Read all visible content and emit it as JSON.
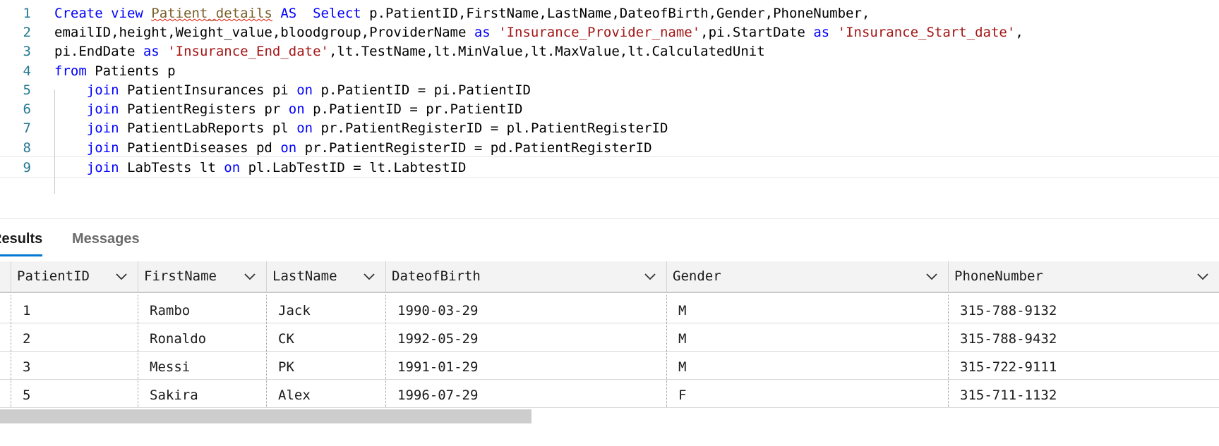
{
  "editor": {
    "line_numbers": [
      "1",
      "2",
      "3",
      "4",
      "5",
      "6",
      "7",
      "8",
      "9"
    ],
    "lines": [
      [
        {
          "t": "Create view ",
          "c": "kw"
        },
        {
          "t": "Patient_details",
          "c": "id-warn"
        },
        {
          "t": " AS  ",
          "c": "kw"
        },
        {
          "t": "Select",
          "c": "kw"
        },
        {
          "t": " p.PatientID,FirstName,LastName,DateofBirth,Gender,PhoneNumber,",
          "c": ""
        }
      ],
      [
        {
          "t": "emailID,height,Weight_value,bloodgroup,ProviderName ",
          "c": ""
        },
        {
          "t": "as",
          "c": "kw"
        },
        {
          "t": " ",
          "c": ""
        },
        {
          "t": "'Insurance_Provider_name'",
          "c": "str"
        },
        {
          "t": ",pi.StartDate ",
          "c": ""
        },
        {
          "t": "as",
          "c": "kw"
        },
        {
          "t": " ",
          "c": ""
        },
        {
          "t": "'Insurance_Start_date'",
          "c": "str"
        },
        {
          "t": ",",
          "c": ""
        }
      ],
      [
        {
          "t": "pi.EndDate ",
          "c": ""
        },
        {
          "t": "as",
          "c": "kw"
        },
        {
          "t": " ",
          "c": ""
        },
        {
          "t": "'Insurance_End_date'",
          "c": "str"
        },
        {
          "t": ",lt.TestName,lt.MinValue,lt.MaxValue,lt.CalculatedUnit",
          "c": ""
        }
      ],
      [
        {
          "t": "from",
          "c": "kw"
        },
        {
          "t": " Patients p",
          "c": ""
        }
      ],
      [
        {
          "t": "    ",
          "c": ""
        },
        {
          "t": "join",
          "c": "kw"
        },
        {
          "t": " PatientInsurances pi ",
          "c": ""
        },
        {
          "t": "on",
          "c": "kw"
        },
        {
          "t": " p.PatientID = pi.PatientID",
          "c": ""
        }
      ],
      [
        {
          "t": "    ",
          "c": ""
        },
        {
          "t": "join",
          "c": "kw"
        },
        {
          "t": " PatientRegisters pr ",
          "c": ""
        },
        {
          "t": "on",
          "c": "kw"
        },
        {
          "t": " p.PatientID = pr.PatientID",
          "c": ""
        }
      ],
      [
        {
          "t": "    ",
          "c": ""
        },
        {
          "t": "join",
          "c": "kw"
        },
        {
          "t": " PatientLabReports pl ",
          "c": ""
        },
        {
          "t": "on",
          "c": "kw"
        },
        {
          "t": " pr.PatientRegisterID = pl.PatientRegisterID",
          "c": ""
        }
      ],
      [
        {
          "t": "    ",
          "c": ""
        },
        {
          "t": "join",
          "c": "kw"
        },
        {
          "t": " PatientDiseases pd ",
          "c": ""
        },
        {
          "t": "on",
          "c": "kw"
        },
        {
          "t": " pr.PatientRegisterID = pd.PatientRegisterID",
          "c": ""
        }
      ],
      [
        {
          "t": "    ",
          "c": ""
        },
        {
          "t": "join",
          "c": "kw"
        },
        {
          "t": " LabTests lt ",
          "c": ""
        },
        {
          "t": "on",
          "c": "kw"
        },
        {
          "t": " pl.LabTestID = lt.LabtestID",
          "c": ""
        }
      ]
    ]
  },
  "tabs": {
    "results_label": "Results",
    "messages_label": "Messages"
  },
  "grid": {
    "columns": [
      "PatientID",
      "FirstName",
      "LastName",
      "DateofBirth",
      "Gender",
      "PhoneNumber"
    ],
    "rows": [
      [
        "1",
        "Rambo",
        "Jack",
        "1990-03-29",
        "M",
        "315-788-9132"
      ],
      [
        "2",
        "Ronaldo",
        "CK",
        "1992-05-29",
        "M",
        "315-788-9432"
      ],
      [
        "3",
        "Messi",
        "PK",
        "1991-01-29",
        "M",
        "315-722-9111"
      ],
      [
        "5",
        "Sakira",
        "Alex",
        "1996-07-29",
        "F",
        "315-711-1132"
      ]
    ]
  }
}
